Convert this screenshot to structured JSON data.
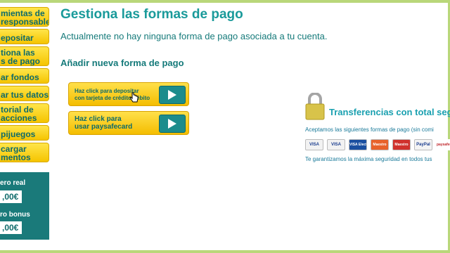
{
  "sidebar": {
    "items": [
      {
        "label": "mientas de\nresponsable"
      },
      {
        "label": "epositar"
      },
      {
        "label": "tiona las\ns de pago"
      },
      {
        "label": "ar fondos"
      },
      {
        "label": "ar tus datos"
      },
      {
        "label": "torial de\nacciones"
      },
      {
        "label": "pijuegos"
      },
      {
        "label": "cargar\nmentos"
      }
    ],
    "balance_real_label": "ero real",
    "balance_real_value": ",00€",
    "balance_bonus_label": "ro bonus",
    "balance_bonus_value": ",00€"
  },
  "main": {
    "title": "Gestiona las formas de pago",
    "no_methods_text": "Actualmente no hay ninguna forma de pago asociada a tu cuenta.",
    "add_title": "Añadir nueva forma de pago",
    "card_button_label": "Haz click para depositar\ncon tarjeta de crédito/débito",
    "paysafe_button_label": "Haz click para\nusar paysafecard"
  },
  "security": {
    "title": "Transferencias con total seg",
    "accept_text": "Aceptamos las siguientes formas de pago (sin comi",
    "cards": [
      "VISA",
      "VISA",
      "VISA Electron",
      "Maestro",
      "Maestro",
      "PayPal",
      "paysafecard"
    ],
    "guarantee_text": "Te garantizamos la máxima seguridad en todos tus"
  },
  "colors": {
    "accent_teal": "#199a9a",
    "button_yellow": "#f5c400",
    "frame_green": "#b9d77a"
  }
}
